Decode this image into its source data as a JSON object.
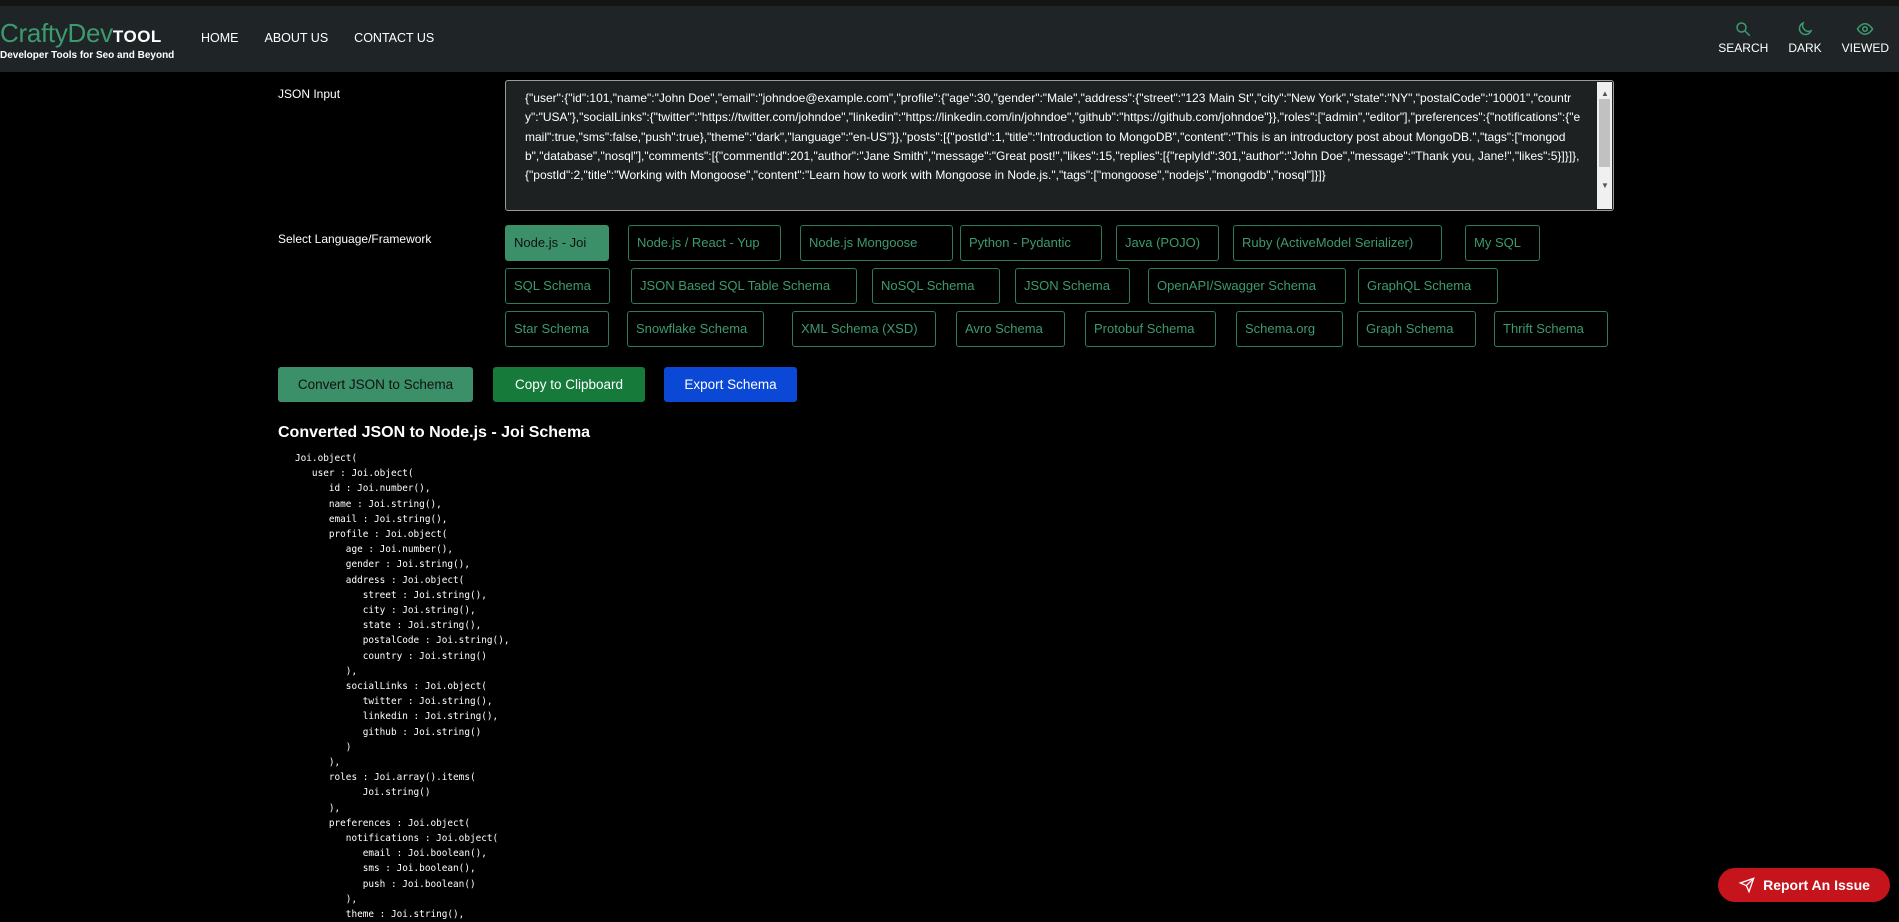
{
  "brand": {
    "name_main": "CraftyDev",
    "name_suffix": "TOOL",
    "tagline": "Developer Tools for Seo and Beyond"
  },
  "nav": {
    "links": [
      "HOME",
      "ABOUT US",
      "CONTACT US"
    ],
    "search": "SEARCH",
    "dark": "DARK",
    "viewed": "VIEWED"
  },
  "json_input": {
    "label": "JSON Input",
    "value": "{\"user\":{\"id\":101,\"name\":\"John Doe\",\"email\":\"johndoe@example.com\",\"profile\":{\"age\":30,\"gender\":\"Male\",\"address\":{\"street\":\"123 Main St\",\"city\":\"New York\",\"state\":\"NY\",\"postalCode\":\"10001\",\"country\":\"USA\"},\"socialLinks\":{\"twitter\":\"https://twitter.com/johndoe\",\"linkedin\":\"https://linkedin.com/in/johndoe\",\"github\":\"https://github.com/johndoe\"}},\"roles\":[\"admin\",\"editor\"],\"preferences\":{\"notifications\":{\"email\":true,\"sms\":false,\"push\":true},\"theme\":\"dark\",\"language\":\"en-US\"}},\"posts\":[{\"postId\":1,\"title\":\"Introduction to MongoDB\",\"content\":\"This is an introductory post about MongoDB.\",\"tags\":[\"mongodb\",\"database\",\"nosql\"],\"comments\":[{\"commentId\":201,\"author\":\"Jane Smith\",\"message\":\"Great post!\",\"likes\":15,\"replies\":[{\"replyId\":301,\"author\":\"John Doe\",\"message\":\"Thank you, Jane!\",\"likes\":5}]}]},{\"postId\":2,\"title\":\"Working with Mongoose\",\"content\":\"Learn how to work with Mongoose in Node.js.\",\"tags\":[\"mongoose\",\"nodejs\",\"mongodb\",\"nosql\"]}]}"
  },
  "language_select": {
    "label": "Select Language/Framework",
    "selected": "Node.js - Joi",
    "options": [
      "Node.js - Joi",
      "Node.js / React - Yup",
      "Node.js Mongoose",
      "Python - Pydantic",
      "Java (POJO)",
      "Ruby (ActiveModel Serializer)",
      "My SQL",
      "SQL Schema",
      "JSON Based SQL Table Schema",
      "NoSQL Schema",
      "JSON Schema",
      "OpenAPI/Swagger Schema",
      "GraphQL Schema",
      "Star Schema",
      "Snowflake Schema",
      "XML Schema (XSD)",
      "Avro Schema",
      "Protobuf Schema",
      "Schema.org",
      "Graph Schema",
      "Thrift Schema"
    ]
  },
  "actions": {
    "convert": "Convert JSON to Schema",
    "copy": "Copy to Clipboard",
    "export": "Export Schema"
  },
  "output": {
    "title": "Converted JSON to Node.js - Joi Schema",
    "code": "Joi.object(\n   user : Joi.object(\n      id : Joi.number(),\n      name : Joi.string(),\n      email : Joi.string(),\n      profile : Joi.object(\n         age : Joi.number(),\n         gender : Joi.string(),\n         address : Joi.object(\n            street : Joi.string(),\n            city : Joi.string(),\n            state : Joi.string(),\n            postalCode : Joi.string(),\n            country : Joi.string()\n         ),\n         socialLinks : Joi.object(\n            twitter : Joi.string(),\n            linkedin : Joi.string(),\n            github : Joi.string()\n         )\n      ),\n      roles : Joi.array().items(\n            Joi.string()\n      ),\n      preferences : Joi.object(\n         notifications : Joi.object(\n            email : Joi.boolean(),\n            sms : Joi.boolean(),\n            push : Joi.boolean()\n         ),\n         theme : Joi.string(),"
  },
  "report_button": "Report An Issue",
  "colors": {
    "accent_green": "#3d9a6f",
    "copy_green": "#157a3a",
    "export_blue": "#0b48d6",
    "report_red": "#c6141d",
    "navbar_bg": "#1f2526"
  }
}
